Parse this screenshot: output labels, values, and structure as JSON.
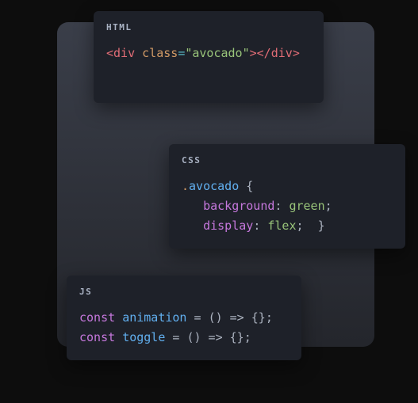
{
  "backdrop": {},
  "cards": {
    "html": {
      "label": "HTML",
      "tokens": {
        "lt1": "<",
        "tag_open": "div",
        "sp1": " ",
        "attr": "class",
        "eq": "=",
        "q1": "\"",
        "str": "avocado",
        "q2": "\"",
        "gt1": ">",
        "lt2": "</",
        "tag_close": "div",
        "gt2": ">"
      }
    },
    "css": {
      "label": "CSS",
      "tokens": {
        "dot": ".",
        "selector": "avocado",
        "sp1": " ",
        "brace_open": "{",
        "nl1": "\n   ",
        "prop1": "background",
        "colon1": ":",
        "sp2": " ",
        "val1": "green",
        "semi1": ";",
        "nl2": "\n   ",
        "prop2": "display",
        "colon2": ":",
        "sp3": " ",
        "val2": "flex",
        "semi2": ";",
        "sp4": "  ",
        "brace_close": "}"
      }
    },
    "js": {
      "label": "JS",
      "tokens": {
        "kw1": "const",
        "sp1": " ",
        "name1": "animation",
        "sp2": " ",
        "eq1": "=",
        "sp3": " ",
        "arrow1": "() => {}",
        "semi1": ";",
        "nl1": "\n",
        "kw2": "const",
        "sp4": " ",
        "name2": "toggle",
        "sp5": " ",
        "eq2": "=",
        "sp6": " ",
        "arrow2": "() => {}",
        "semi2": ";"
      }
    }
  }
}
